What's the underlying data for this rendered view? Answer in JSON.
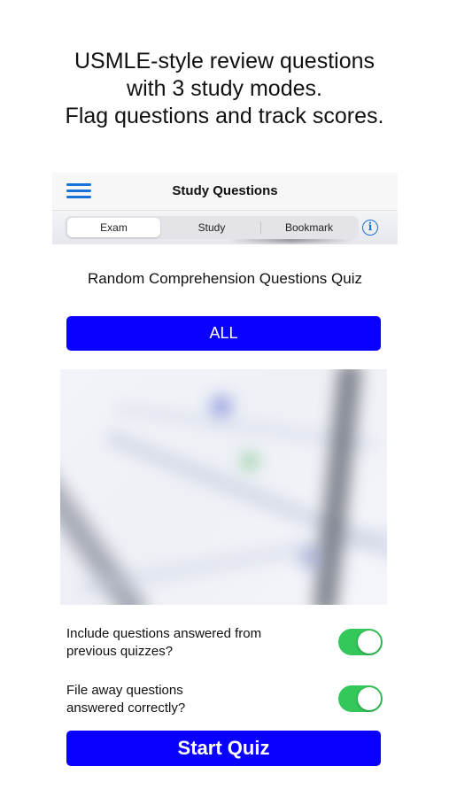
{
  "promo": {
    "line1": "USMLE-style review questions",
    "line2": "with 3 study modes.",
    "line3": "Flag questions and track scores."
  },
  "navbar": {
    "title": "Study Questions",
    "menu_icon": "hamburger-menu-icon"
  },
  "segments": {
    "items": [
      "Exam",
      "Study",
      "Bookmark"
    ],
    "selected": "Exam",
    "info_icon": "info-circle-icon",
    "info_glyph": "i"
  },
  "quiz": {
    "title": "Random Comprehension Questions Quiz",
    "category_button": "ALL"
  },
  "options": {
    "include_previous": {
      "line1": "Include questions answered from",
      "line2": "previous quizzes?",
      "enabled": true
    },
    "file_away_correct": {
      "line1": "File away questions",
      "line2": "answered correctly?",
      "enabled": true
    }
  },
  "actions": {
    "start_label": "Start Quiz"
  },
  "colors": {
    "primary_button": "#0a00ff",
    "toggle_on": "#34c759",
    "accent": "#1a73d6"
  }
}
